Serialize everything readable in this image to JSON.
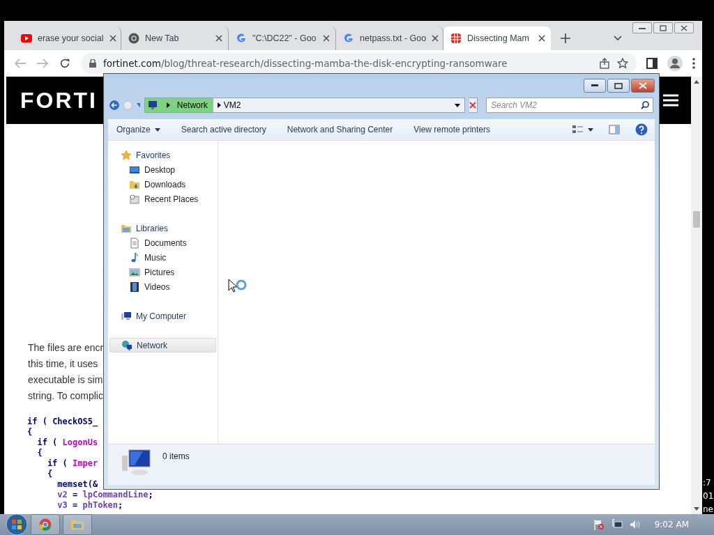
{
  "browser": {
    "tabs": [
      {
        "title": "erase your social",
        "kind": "video",
        "selected": false
      },
      {
        "title": "New Tab",
        "kind": "browser",
        "selected": false
      },
      {
        "title": "\"C:\\DC22\" - Goo",
        "kind": "search",
        "selected": false
      },
      {
        "title": "netpass.txt - Goo",
        "kind": "search",
        "selected": false
      },
      {
        "title": "Dissecting Mam",
        "kind": "site",
        "selected": true
      }
    ],
    "address": {
      "domain": "fortinet.com",
      "path": "/blog/threat-research/dissecting-mamba-the-disk-encrypting-ransomware"
    }
  },
  "page": {
    "logo": "FORTI",
    "paragraph_lines": [
      "The files are encr",
      "this time, it uses",
      "executable is sim",
      "string. To complic"
    ],
    "code_lines": [
      [
        {
          "text": "if ( ",
          "kind": "plain"
        },
        {
          "text": "CheckOS5_",
          "kind": "call"
        }
      ],
      [
        {
          "text": "{",
          "kind": "plain"
        }
      ],
      [
        {
          "text": "  if ( ",
          "kind": "plain"
        },
        {
          "text": "LogonUs",
          "kind": "api"
        }
      ],
      [
        {
          "text": "  {",
          "kind": "plain"
        }
      ],
      [
        {
          "text": "    if ( ",
          "kind": "plain"
        },
        {
          "text": "Imper",
          "kind": "api"
        }
      ],
      [
        {
          "text": "    {",
          "kind": "plain"
        }
      ],
      [
        {
          "text": "      memset(&",
          "kind": "call"
        }
      ],
      [
        {
          "text": "      v2",
          "kind": "var"
        },
        {
          "text": " = ",
          "kind": "plain"
        },
        {
          "text": "lpCommandLine",
          "kind": "var"
        },
        {
          "text": ";",
          "kind": "plain"
        }
      ],
      [
        {
          "text": "      v3",
          "kind": "var"
        },
        {
          "text": " = ",
          "kind": "plain"
        },
        {
          "text": "phToken",
          "kind": "var"
        },
        {
          "text": ";",
          "kind": "plain"
        }
      ]
    ]
  },
  "explorer": {
    "breadcrumb": [
      "Network",
      "VM2"
    ],
    "search": {
      "placeholder": "Search VM2"
    },
    "toolbar": [
      {
        "label": "Organize",
        "kind": "menu"
      },
      {
        "label": "Search active directory",
        "kind": "command"
      },
      {
        "label": "Network and Sharing Center",
        "kind": "command"
      },
      {
        "label": "View remote printers",
        "kind": "command"
      }
    ],
    "nav": [
      {
        "label": "Favorites",
        "kind": "star",
        "selected": false,
        "children": [
          {
            "label": "Desktop",
            "kind": "desktop",
            "selected": false
          },
          {
            "label": "Downloads",
            "kind": "downloads",
            "selected": false
          },
          {
            "label": "Recent Places",
            "kind": "recent",
            "selected": false
          }
        ]
      },
      {
        "label": "Libraries",
        "kind": "library",
        "selected": false,
        "children": [
          {
            "label": "Documents",
            "kind": "document",
            "selected": false
          },
          {
            "label": "Music",
            "kind": "music",
            "selected": false
          },
          {
            "label": "Pictures",
            "kind": "pictures",
            "selected": false
          },
          {
            "label": "Videos",
            "kind": "videos",
            "selected": false
          }
        ]
      },
      {
        "label": "My Computer",
        "kind": "computer",
        "selected": false
      },
      {
        "label": "Network",
        "kind": "network",
        "selected": true
      }
    ],
    "status": "0 items"
  },
  "taskbar": {
    "clock": "9:02 AM"
  },
  "desktop_fragments": [
    ":7",
    "01",
    "ne"
  ]
}
